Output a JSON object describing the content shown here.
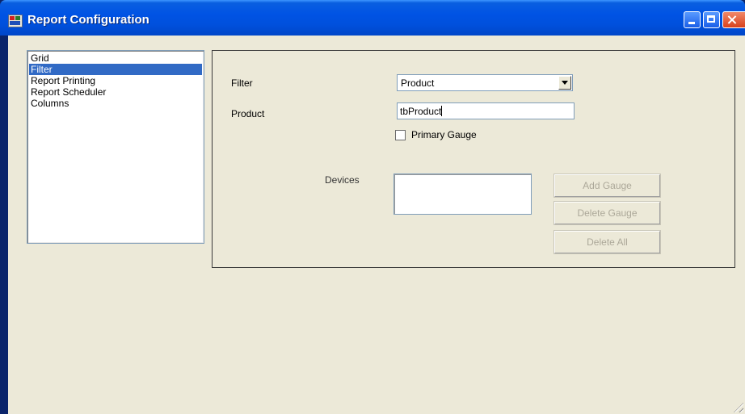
{
  "window": {
    "title": "Report Configuration",
    "controls": [
      "minimize-icon",
      "maximize-icon",
      "close-icon"
    ]
  },
  "sidebar": {
    "items": [
      {
        "label": "Grid",
        "selected": false
      },
      {
        "label": "Filter",
        "selected": true
      },
      {
        "label": "Report Printing",
        "selected": false
      },
      {
        "label": "Report Scheduler",
        "selected": false
      },
      {
        "label": "Columns",
        "selected": false
      }
    ]
  },
  "filter_panel": {
    "filter_label": "Filter",
    "filter_value": "Product",
    "product_label": "Product",
    "product_value": "tbProduct",
    "primary_gauge_label": "Primary Gauge",
    "primary_gauge_checked": false,
    "devices_label": "Devices",
    "buttons": {
      "add_gauge": "Add Gauge",
      "delete_gauge": "Delete Gauge",
      "delete_all": "Delete All"
    }
  },
  "colors": {
    "titlebar": "#0053e4",
    "selection": "#316ac5",
    "client_bg": "#ece9d8",
    "disabled_text": "#aca899"
  }
}
